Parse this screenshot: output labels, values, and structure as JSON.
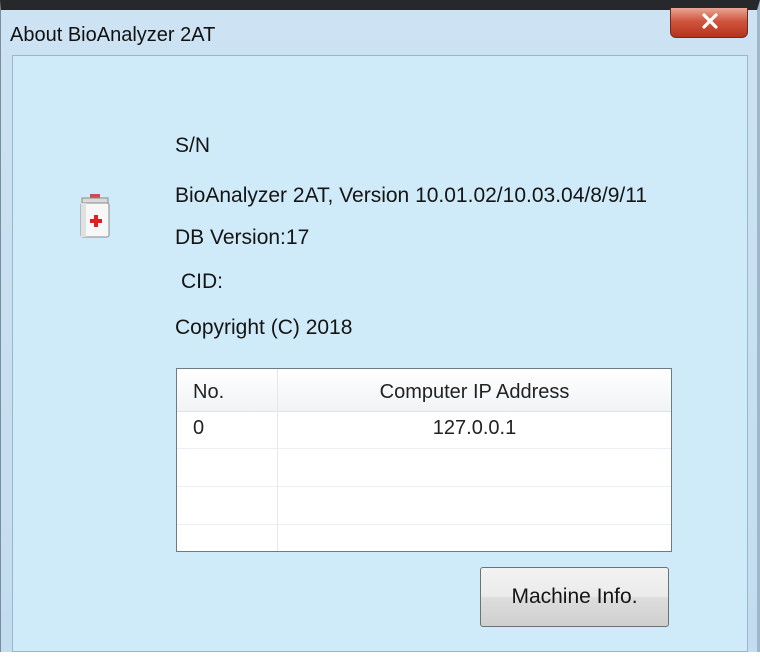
{
  "window": {
    "title": "About BioAnalyzer 2AT",
    "close_icon": "close-x-icon"
  },
  "app_icon": "first-aid-kit-icon",
  "info": {
    "serial": "S/N",
    "version": "BioAnalyzer 2AT, Version 10.01.02/10.03.04/8/9/11",
    "db_version": "DB Version:17",
    "cid": "CID:",
    "copyright": "Copyright (C) 2018"
  },
  "ip_table": {
    "headers": [
      "No.",
      "Computer IP Address"
    ],
    "rows": [
      {
        "no": "0",
        "address": "127.0.0.1"
      }
    ]
  },
  "buttons": {
    "machine_info": "Machine Info."
  },
  "colors": {
    "window_bg": "#cfeaf8",
    "close_button": "#c7432b",
    "icon_cross": "#e02020"
  }
}
